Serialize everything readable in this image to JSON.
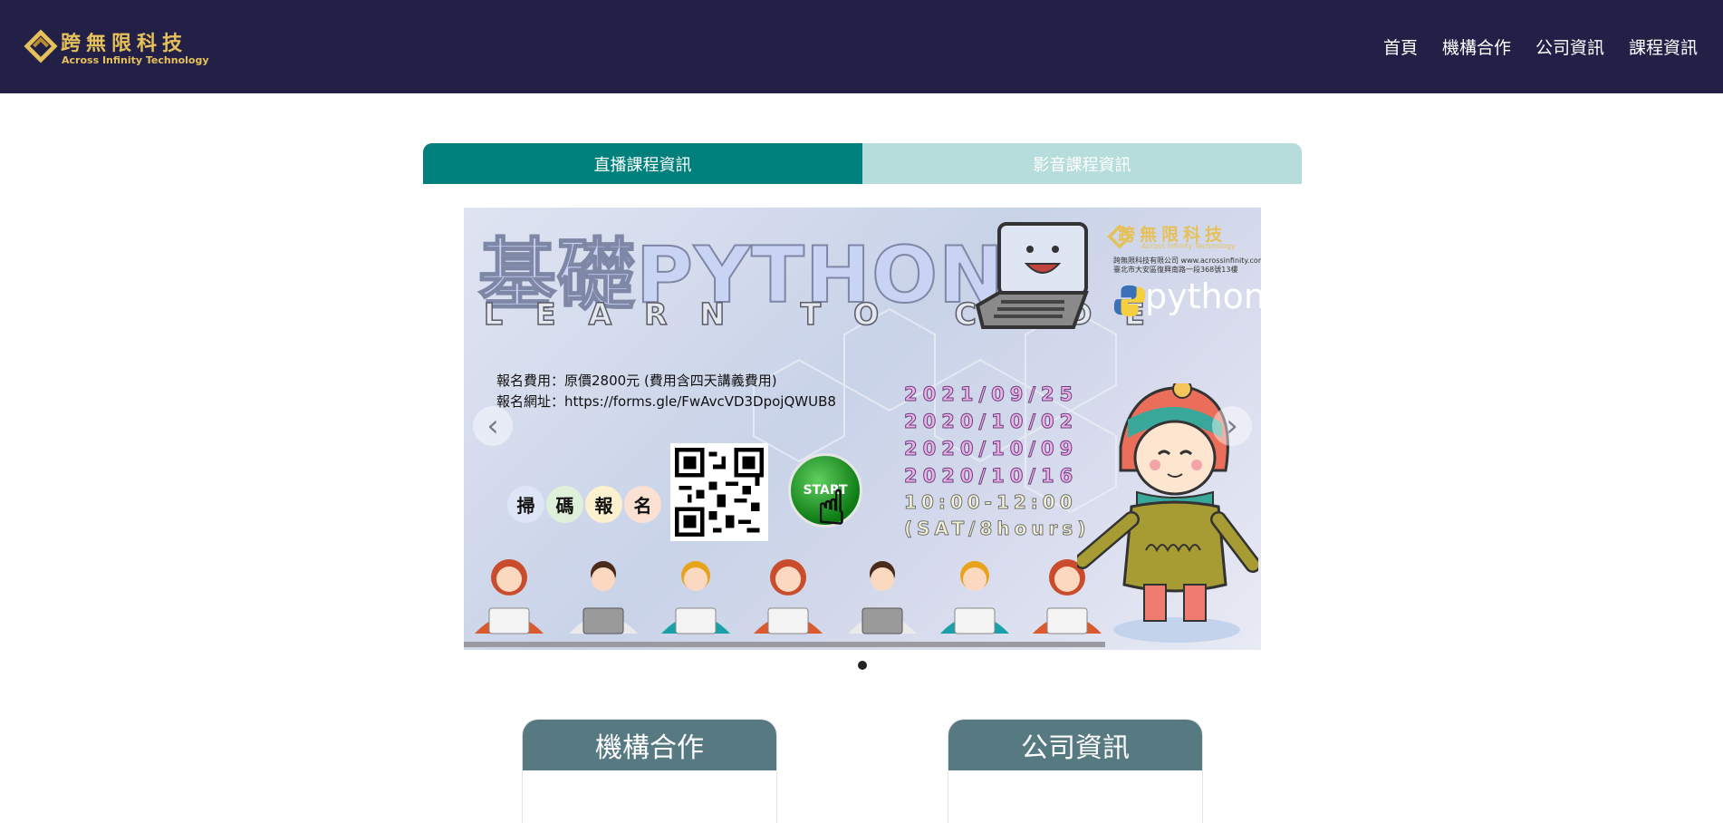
{
  "header": {
    "logo_cn": "跨無限科技",
    "logo_en": "Across Infinity Technology",
    "brand_color": "#222047",
    "accent_color": "#e6c15a",
    "nav": [
      {
        "label": "首頁"
      },
      {
        "label": "機構合作"
      },
      {
        "label": "公司資訊"
      },
      {
        "label": "課程資訊"
      }
    ]
  },
  "tabs": [
    {
      "label": "直播課程資訊",
      "active": true,
      "color": "#00807d"
    },
    {
      "label": "影音課程資訊",
      "active": false,
      "color": "#b6dcdb"
    }
  ],
  "carousel": {
    "prev_icon": "chevron-left-icon",
    "next_icon": "chevron-right-icon",
    "dots": 1,
    "active_dot": 1,
    "slide": {
      "title": "基礎PYTHON",
      "subtitle": "LEARN TO CODE",
      "logo_cn": "跨無限科技",
      "logo_en": "Across Infinity Technology",
      "company_line1": "跨無限科技有限公司 www.acrossinfinity.com",
      "company_line2": "臺北市大安區復興南路一段368號13樓",
      "python_label": "python",
      "fee": "報名費用：原價2800元 (費用含四天講義費用)",
      "url": "報名網址：https://forms.gle/FwAvcVD3DpojQWUB8",
      "dates": [
        "2021/09/25",
        "2020/10/02",
        "2020/10/09",
        "2020/10/16"
      ],
      "time": "10:00-12:00",
      "time_note": "(SAT/8hours)",
      "scan_chars": [
        "掃",
        "碼",
        "報",
        "名"
      ],
      "start_label": "START"
    }
  },
  "cards": [
    {
      "title": "機構合作"
    },
    {
      "title": "公司資訊"
    }
  ]
}
